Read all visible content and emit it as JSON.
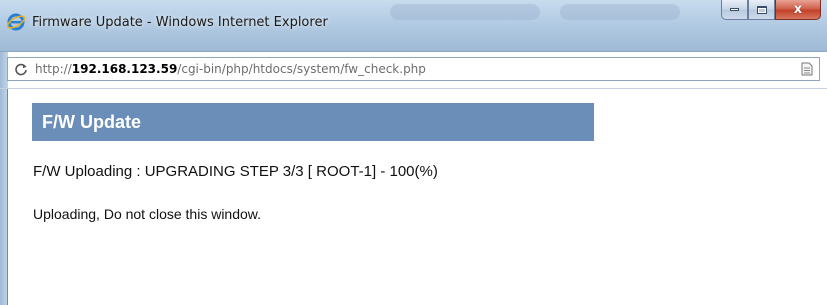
{
  "window": {
    "title": "Firmware Update - Windows Internet Explorer",
    "close_glyph": "x",
    "icons": {
      "app": "internet-explorer-icon",
      "minimize": "minimize-icon",
      "maximize": "maximize-icon",
      "close": "close-icon"
    }
  },
  "address_bar": {
    "scheme": "http://",
    "host": "192.168.123.59",
    "path": "/cgi-bin/php/htdocs/system/fw_check.php",
    "icons": {
      "reload": "reload-icon",
      "page": "page-icon"
    }
  },
  "page": {
    "header_title": "F/W Update",
    "status": "F/W Uploading : UPGRADING STEP 3/3 [ ROOT-1] - 100(%)",
    "notice": "Uploading, Do not close this window."
  },
  "colors": {
    "header_bg": "#6b8eb8",
    "header_text": "#ffffff",
    "title_bar": "#b7cfe6",
    "close_button": "#c2402a"
  }
}
